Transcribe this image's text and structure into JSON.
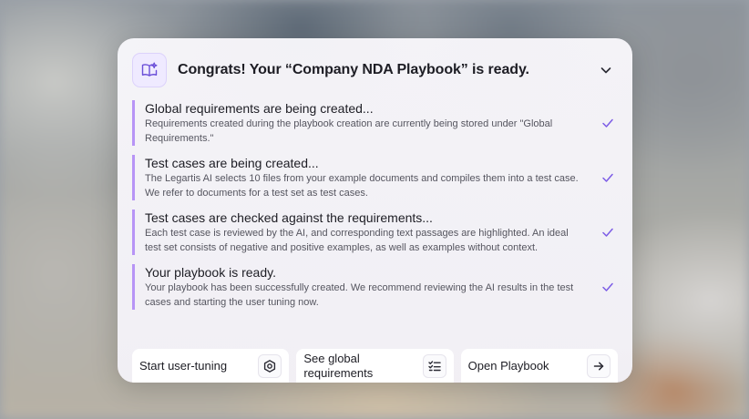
{
  "dialog": {
    "title": "Congrats! Your “Company NDA Playbook” is ready."
  },
  "steps": [
    {
      "title": "Global requirements are being created...",
      "description": "Requirements created during the playbook creation are currently being stored under \"Global Requirements.\""
    },
    {
      "title": "Test cases are being created...",
      "description": "The Legartis AI selects 10 files from your example documents and compiles them into a test case. We refer to documents for a test set as test cases."
    },
    {
      "title": "Test cases are checked against the requirements...",
      "description": "Each test case is reviewed by the AI, and corresponding text passages are highlighted. An ideal test set consists of negative and positive examples, as well as examples without context."
    },
    {
      "title": "Your playbook is ready.",
      "description": "Your playbook has been successfully created. We recommend reviewing the AI results in the test cases and starting the user tuning now."
    }
  ],
  "actions": {
    "user_tuning": "Start user-tuning",
    "global_requirements": "See global requirements",
    "open_playbook": "Open Playbook"
  },
  "colors": {
    "accent": "#b794f6",
    "check": "#7c5ce6"
  },
  "icons": {
    "app": "book-sparkle-icon",
    "collapse": "chevron-down-icon",
    "step_done": "check-icon",
    "user_tuning": "hexagon-settings-icon",
    "global_requirements": "checklist-icon",
    "open_playbook": "arrow-right-icon"
  }
}
